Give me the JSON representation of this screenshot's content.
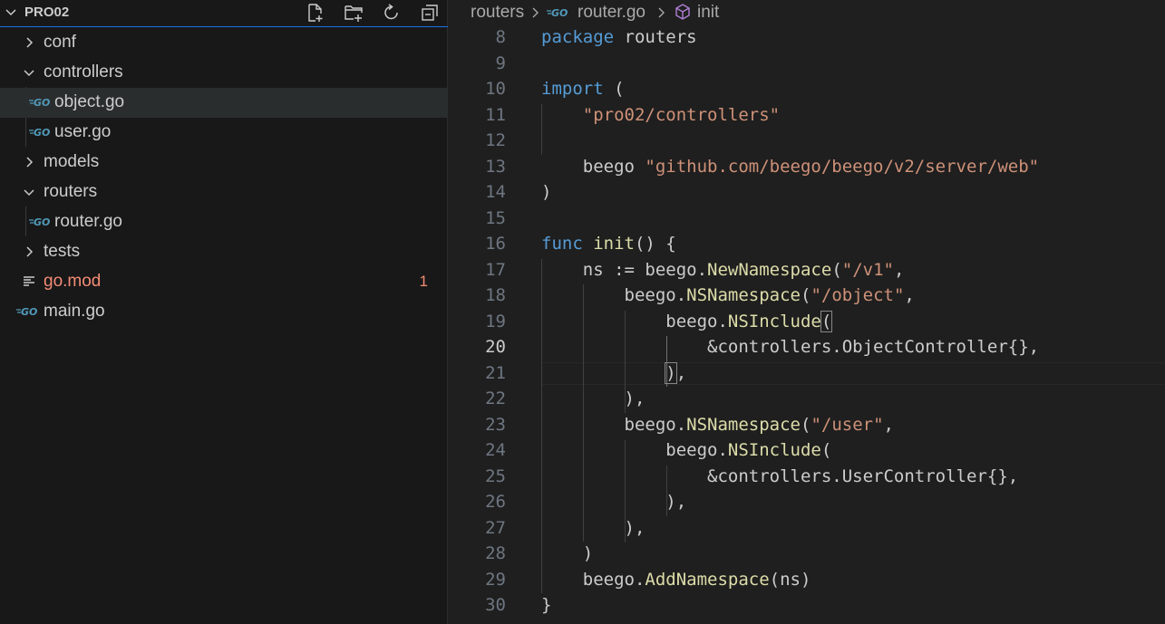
{
  "explorer": {
    "title": "PRO02",
    "header_icons": [
      "new-file-icon",
      "new-folder-icon",
      "refresh-icon",
      "collapse-all-icon"
    ],
    "items": [
      {
        "label": "conf",
        "type": "folder",
        "expanded": false,
        "depth": 1
      },
      {
        "label": "controllers",
        "type": "folder",
        "expanded": true,
        "depth": 1
      },
      {
        "label": "object.go",
        "type": "go-file",
        "depth": 2,
        "selected": true
      },
      {
        "label": "user.go",
        "type": "go-file",
        "depth": 2
      },
      {
        "label": "models",
        "type": "folder",
        "expanded": false,
        "depth": 1
      },
      {
        "label": "routers",
        "type": "folder",
        "expanded": true,
        "depth": 1
      },
      {
        "label": "router.go",
        "type": "go-file",
        "depth": 2
      },
      {
        "label": "tests",
        "type": "folder",
        "expanded": false,
        "depth": 1
      },
      {
        "label": "go.mod",
        "type": "mod-file",
        "depth": 1,
        "badge": "1",
        "color": "#f38b76"
      },
      {
        "label": "main.go",
        "type": "go-file",
        "depth": 0
      }
    ]
  },
  "breadcrumb": {
    "folder": "routers",
    "file": "router.go",
    "symbol": "init"
  },
  "editor": {
    "active_line": "20",
    "lines": [
      {
        "n": "8"
      },
      {
        "n": "9"
      },
      {
        "n": "10"
      },
      {
        "n": "11"
      },
      {
        "n": "12"
      },
      {
        "n": "13"
      },
      {
        "n": "14"
      },
      {
        "n": "15"
      },
      {
        "n": "16"
      },
      {
        "n": "17"
      },
      {
        "n": "18"
      },
      {
        "n": "19"
      },
      {
        "n": "20"
      },
      {
        "n": "21"
      },
      {
        "n": "22"
      },
      {
        "n": "23"
      },
      {
        "n": "24"
      },
      {
        "n": "25"
      },
      {
        "n": "26"
      },
      {
        "n": "27"
      },
      {
        "n": "28"
      },
      {
        "n": "29"
      },
      {
        "n": "30"
      }
    ],
    "tokens": {
      "l8": [
        "package",
        " routers"
      ],
      "l10": [
        "import",
        " ("
      ],
      "l11": [
        "    ",
        "\"pro02/controllers\""
      ],
      "l13": [
        "    beego ",
        "\"github.com/beego/beego/v2/server/web\""
      ],
      "l14": [
        ")"
      ],
      "l16": [
        "func",
        " ",
        "init",
        "() {"
      ],
      "l17": [
        "    ns := beego.",
        "NewNamespace",
        "(",
        "\"/v1\"",
        ","
      ],
      "l18": [
        "        beego.",
        "NSNamespace",
        "(",
        "\"/object\"",
        ","
      ],
      "l19": [
        "            beego.",
        "NSInclude",
        "("
      ],
      "l20": [
        "                &controllers.ObjectController{},"
      ],
      "l21": [
        "            ",
        ")",
        ","
      ],
      "l22": [
        "        ),"
      ],
      "l23": [
        "        beego.",
        "NSNamespace",
        "(",
        "\"/user\"",
        ","
      ],
      "l24": [
        "            beego.",
        "NSInclude",
        "("
      ],
      "l25": [
        "                &controllers.UserController{},"
      ],
      "l26": [
        "            ),"
      ],
      "l27": [
        "        ),"
      ],
      "l28": [
        "    )"
      ],
      "l29": [
        "    beego.",
        "AddNamespace",
        "(ns)"
      ],
      "l30": [
        "}"
      ]
    }
  },
  "colors": {
    "keyword": "#569cd6",
    "string": "#ce9178",
    "function": "#dcdcaa",
    "text": "#cccccc",
    "line_number": "#6e7681",
    "go_icon": "#519aba",
    "git_modified": "#f38b76"
  }
}
